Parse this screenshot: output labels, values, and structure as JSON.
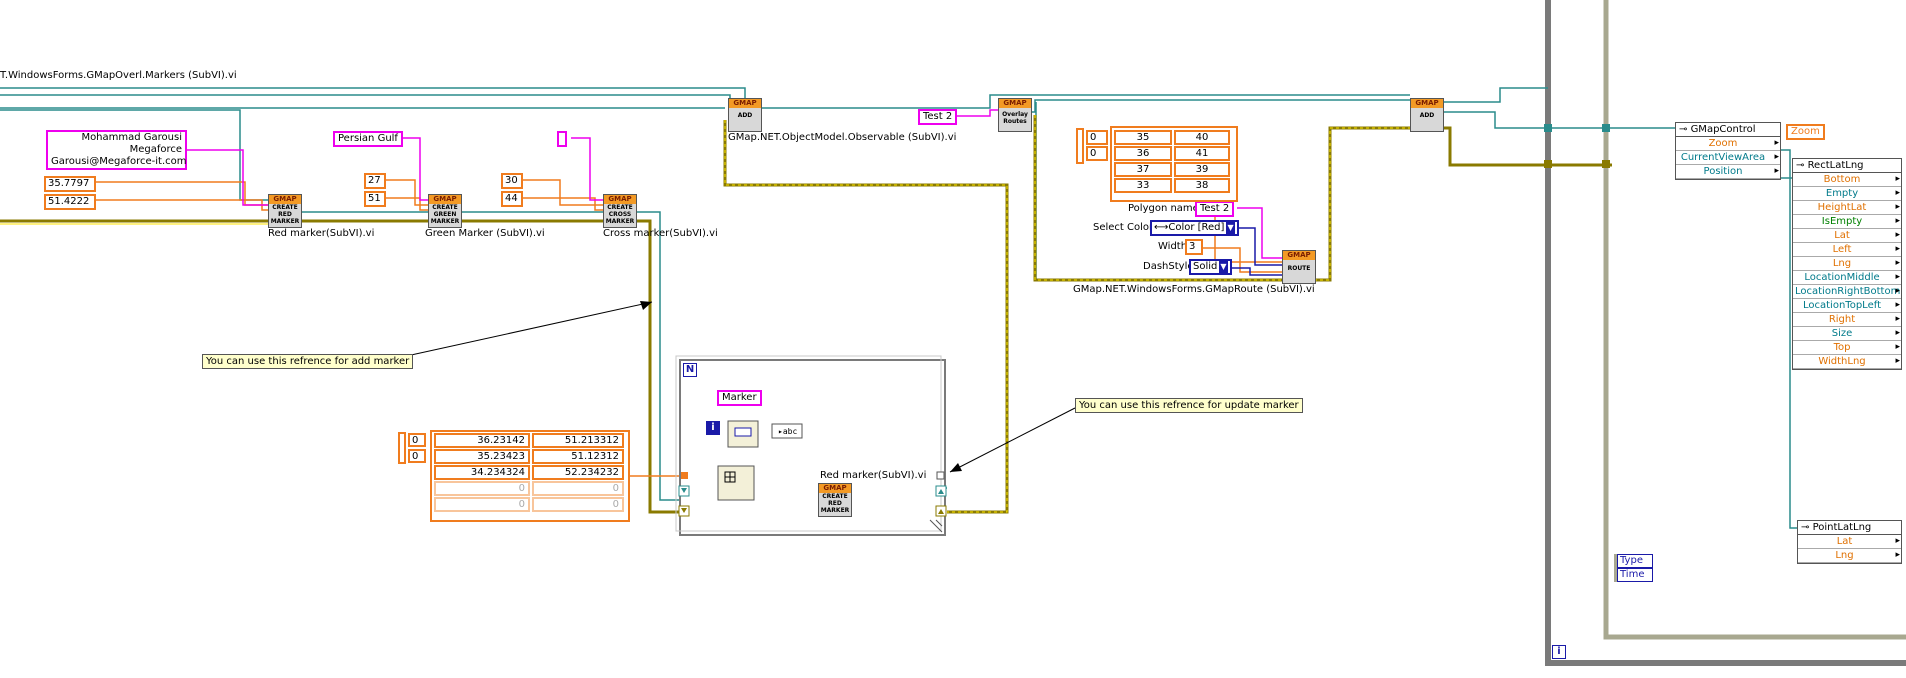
{
  "labels": {
    "top_markers_vi": "T.WindowsForms.GMapOverl.Markers (SubVI).vi",
    "observable_vi": "GMap.NET.ObjectModel.Observable (SubVI).vi",
    "route_vi": "GMap.NET.WindowsForms.GMapRoute (SubVI).vi",
    "red_marker_vi": "Red marker(SubVI).vi",
    "green_marker_vi": "Green Marker (SubVI).vi",
    "cross_marker_vi": "Cross marker(SubVI).vi",
    "inner_red_marker_vi": "Red marker(SubVI).vi",
    "polygon_name_label": "Polygon name",
    "select_color_label": "Select Color",
    "width_label": "Width",
    "dashstyle_label": "DashStyle"
  },
  "constants": {
    "address_lines": [
      "Mohammad Garousi",
      "Megaforce",
      "Garousi@Megaforce-it.com"
    ],
    "red_lat": "35.7797",
    "red_lng": "51.4222",
    "green_label": "Persian Gulf",
    "green_lat": "27",
    "green_lng": "51",
    "cross_lat": "30",
    "cross_lng": "44",
    "route_name": "Test 2",
    "polygon_name": "Test 2",
    "color_value": "Color [Red]",
    "width_value": "3",
    "dashstyle_value": "Solid",
    "marker_label": "Marker",
    "zoom_label": "Zoom"
  },
  "route_array": {
    "index": [
      "0",
      "0"
    ],
    "rows": [
      [
        "35",
        "40"
      ],
      [
        "36",
        "41"
      ],
      [
        "37",
        "39"
      ],
      [
        "33",
        "38"
      ]
    ]
  },
  "marker_array": {
    "index": [
      "0",
      "0"
    ],
    "rows": [
      [
        "36.23142",
        "51.213312"
      ],
      [
        "35.23423",
        "51.12312"
      ],
      [
        "34.234324",
        "52.234232"
      ],
      [
        "0",
        "0"
      ],
      [
        "0",
        "0"
      ]
    ]
  },
  "subvi_icons": {
    "red": {
      "top": "GMAP",
      "lines": [
        "CREATE",
        "RED",
        "MARKER"
      ]
    },
    "green": {
      "top": "GMAP",
      "lines": [
        "CREATE",
        "GREEN",
        "MARKER"
      ]
    },
    "cross": {
      "top": "GMAP",
      "lines": [
        "CREATE",
        "CROSS",
        "MARKER"
      ]
    },
    "add1": {
      "top": "GMAP",
      "lines": [
        "ADD"
      ]
    },
    "overlay": {
      "top": "GMAP",
      "lines": [
        "Overlay",
        "Routes"
      ]
    },
    "add2": {
      "top": "GMAP",
      "lines": [
        "ADD"
      ]
    },
    "route": {
      "top": "GMAP",
      "lines": [
        "ROUTE"
      ]
    },
    "inner_red": {
      "top": "GMAP",
      "lines": [
        "CREATE",
        "RED",
        "MARKER"
      ]
    }
  },
  "comments": {
    "add_marker": "You can use this refrence for add marker",
    "update_marker": "You can use this refrence for update marker"
  },
  "gmap_control": {
    "title": "GMapControl",
    "rows": [
      "Zoom",
      "CurrentViewArea",
      "Position"
    ]
  },
  "rect_latlng": {
    "title": "RectLatLng",
    "rows": [
      "Bottom",
      "Empty",
      "HeightLat",
      "IsEmpty",
      "Lat",
      "Left",
      "Lng",
      "LocationMiddle",
      "LocationRightBottom",
      "LocationTopLeft",
      "Right",
      "Size",
      "Top",
      "WidthLng"
    ]
  },
  "point_latlng": {
    "title": "PointLatLng",
    "rows": [
      "Lat",
      "Lng"
    ]
  },
  "event_data": [
    "Type",
    "Time"
  ],
  "loop_icons": {
    "for_loop": "N",
    "iteration": "i",
    "outer_iteration": "i"
  },
  "colors": {
    "orange": "#f07c1e",
    "pink": "#ee00ee",
    "teal": "#2a8c8c",
    "refnum": "#8a7a00",
    "blue": "#1a1aa8"
  }
}
